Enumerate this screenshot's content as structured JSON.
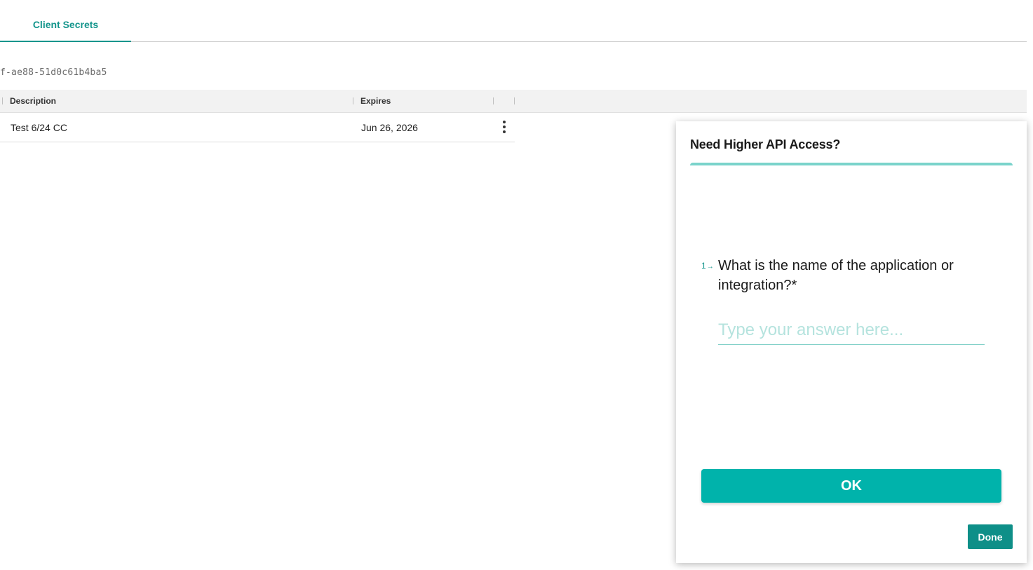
{
  "tabs": [
    {
      "label": "Client Secrets",
      "active": true
    }
  ],
  "client_id_fragment": "f-ae88-51d0c61b4ba5",
  "table": {
    "columns": [
      "Description",
      "Expires"
    ],
    "rows": [
      {
        "description": "Test 6/24 CC",
        "expires": "Jun 26, 2026",
        "actions_icon": "more-vertical-icon"
      }
    ]
  },
  "panel": {
    "title": "Need Higher API Access?",
    "question": {
      "number": "1",
      "arrow": "→",
      "text": "What is the name of the application or integration?*",
      "placeholder": "Type your answer here...",
      "value": ""
    },
    "ok_label": "OK",
    "done_label": "Done"
  },
  "colors": {
    "accent": "#14958c",
    "button": "#00b3ab",
    "done": "#0e8f88"
  }
}
